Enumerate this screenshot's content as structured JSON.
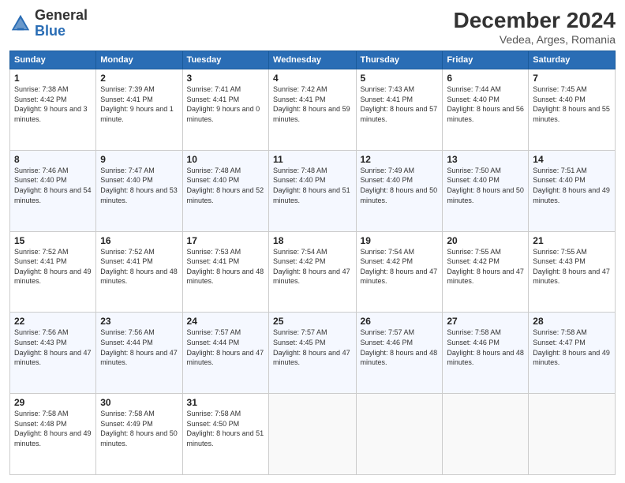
{
  "header": {
    "logo_general": "General",
    "logo_blue": "Blue",
    "month": "December 2024",
    "location": "Vedea, Arges, Romania"
  },
  "days_of_week": [
    "Sunday",
    "Monday",
    "Tuesday",
    "Wednesday",
    "Thursday",
    "Friday",
    "Saturday"
  ],
  "weeks": [
    [
      {
        "day": "1",
        "sunrise": "Sunrise: 7:38 AM",
        "sunset": "Sunset: 4:42 PM",
        "daylight": "Daylight: 9 hours and 3 minutes."
      },
      {
        "day": "2",
        "sunrise": "Sunrise: 7:39 AM",
        "sunset": "Sunset: 4:41 PM",
        "daylight": "Daylight: 9 hours and 1 minute."
      },
      {
        "day": "3",
        "sunrise": "Sunrise: 7:41 AM",
        "sunset": "Sunset: 4:41 PM",
        "daylight": "Daylight: 9 hours and 0 minutes."
      },
      {
        "day": "4",
        "sunrise": "Sunrise: 7:42 AM",
        "sunset": "Sunset: 4:41 PM",
        "daylight": "Daylight: 8 hours and 59 minutes."
      },
      {
        "day": "5",
        "sunrise": "Sunrise: 7:43 AM",
        "sunset": "Sunset: 4:41 PM",
        "daylight": "Daylight: 8 hours and 57 minutes."
      },
      {
        "day": "6",
        "sunrise": "Sunrise: 7:44 AM",
        "sunset": "Sunset: 4:40 PM",
        "daylight": "Daylight: 8 hours and 56 minutes."
      },
      {
        "day": "7",
        "sunrise": "Sunrise: 7:45 AM",
        "sunset": "Sunset: 4:40 PM",
        "daylight": "Daylight: 8 hours and 55 minutes."
      }
    ],
    [
      {
        "day": "8",
        "sunrise": "Sunrise: 7:46 AM",
        "sunset": "Sunset: 4:40 PM",
        "daylight": "Daylight: 8 hours and 54 minutes."
      },
      {
        "day": "9",
        "sunrise": "Sunrise: 7:47 AM",
        "sunset": "Sunset: 4:40 PM",
        "daylight": "Daylight: 8 hours and 53 minutes."
      },
      {
        "day": "10",
        "sunrise": "Sunrise: 7:48 AM",
        "sunset": "Sunset: 4:40 PM",
        "daylight": "Daylight: 8 hours and 52 minutes."
      },
      {
        "day": "11",
        "sunrise": "Sunrise: 7:48 AM",
        "sunset": "Sunset: 4:40 PM",
        "daylight": "Daylight: 8 hours and 51 minutes."
      },
      {
        "day": "12",
        "sunrise": "Sunrise: 7:49 AM",
        "sunset": "Sunset: 4:40 PM",
        "daylight": "Daylight: 8 hours and 50 minutes."
      },
      {
        "day": "13",
        "sunrise": "Sunrise: 7:50 AM",
        "sunset": "Sunset: 4:40 PM",
        "daylight": "Daylight: 8 hours and 50 minutes."
      },
      {
        "day": "14",
        "sunrise": "Sunrise: 7:51 AM",
        "sunset": "Sunset: 4:40 PM",
        "daylight": "Daylight: 8 hours and 49 minutes."
      }
    ],
    [
      {
        "day": "15",
        "sunrise": "Sunrise: 7:52 AM",
        "sunset": "Sunset: 4:41 PM",
        "daylight": "Daylight: 8 hours and 49 minutes."
      },
      {
        "day": "16",
        "sunrise": "Sunrise: 7:52 AM",
        "sunset": "Sunset: 4:41 PM",
        "daylight": "Daylight: 8 hours and 48 minutes."
      },
      {
        "day": "17",
        "sunrise": "Sunrise: 7:53 AM",
        "sunset": "Sunset: 4:41 PM",
        "daylight": "Daylight: 8 hours and 48 minutes."
      },
      {
        "day": "18",
        "sunrise": "Sunrise: 7:54 AM",
        "sunset": "Sunset: 4:42 PM",
        "daylight": "Daylight: 8 hours and 47 minutes."
      },
      {
        "day": "19",
        "sunrise": "Sunrise: 7:54 AM",
        "sunset": "Sunset: 4:42 PM",
        "daylight": "Daylight: 8 hours and 47 minutes."
      },
      {
        "day": "20",
        "sunrise": "Sunrise: 7:55 AM",
        "sunset": "Sunset: 4:42 PM",
        "daylight": "Daylight: 8 hours and 47 minutes."
      },
      {
        "day": "21",
        "sunrise": "Sunrise: 7:55 AM",
        "sunset": "Sunset: 4:43 PM",
        "daylight": "Daylight: 8 hours and 47 minutes."
      }
    ],
    [
      {
        "day": "22",
        "sunrise": "Sunrise: 7:56 AM",
        "sunset": "Sunset: 4:43 PM",
        "daylight": "Daylight: 8 hours and 47 minutes."
      },
      {
        "day": "23",
        "sunrise": "Sunrise: 7:56 AM",
        "sunset": "Sunset: 4:44 PM",
        "daylight": "Daylight: 8 hours and 47 minutes."
      },
      {
        "day": "24",
        "sunrise": "Sunrise: 7:57 AM",
        "sunset": "Sunset: 4:44 PM",
        "daylight": "Daylight: 8 hours and 47 minutes."
      },
      {
        "day": "25",
        "sunrise": "Sunrise: 7:57 AM",
        "sunset": "Sunset: 4:45 PM",
        "daylight": "Daylight: 8 hours and 47 minutes."
      },
      {
        "day": "26",
        "sunrise": "Sunrise: 7:57 AM",
        "sunset": "Sunset: 4:46 PM",
        "daylight": "Daylight: 8 hours and 48 minutes."
      },
      {
        "day": "27",
        "sunrise": "Sunrise: 7:58 AM",
        "sunset": "Sunset: 4:46 PM",
        "daylight": "Daylight: 8 hours and 48 minutes."
      },
      {
        "day": "28",
        "sunrise": "Sunrise: 7:58 AM",
        "sunset": "Sunset: 4:47 PM",
        "daylight": "Daylight: 8 hours and 49 minutes."
      }
    ],
    [
      {
        "day": "29",
        "sunrise": "Sunrise: 7:58 AM",
        "sunset": "Sunset: 4:48 PM",
        "daylight": "Daylight: 8 hours and 49 minutes."
      },
      {
        "day": "30",
        "sunrise": "Sunrise: 7:58 AM",
        "sunset": "Sunset: 4:49 PM",
        "daylight": "Daylight: 8 hours and 50 minutes."
      },
      {
        "day": "31",
        "sunrise": "Sunrise: 7:58 AM",
        "sunset": "Sunset: 4:50 PM",
        "daylight": "Daylight: 8 hours and 51 minutes."
      },
      null,
      null,
      null,
      null
    ]
  ]
}
